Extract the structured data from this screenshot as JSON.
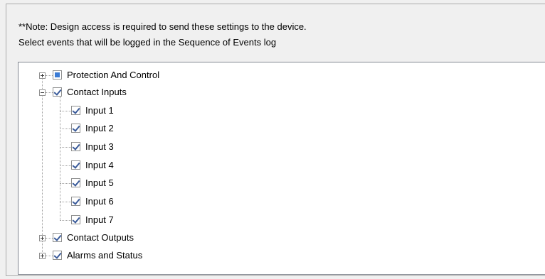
{
  "note": "**Note: Design access is required to send these settings to the device.",
  "instruction": "Select events that will be logged in the Sequence of Events log",
  "tree": {
    "protection_and_control": {
      "label": "Protection And Control",
      "state": "partial",
      "expander": "collapsed"
    },
    "contact_inputs": {
      "label": "Contact Inputs",
      "state": "checked",
      "expander": "expanded",
      "children": [
        {
          "label": "Input 1",
          "state": "checked"
        },
        {
          "label": "Input 2",
          "state": "checked"
        },
        {
          "label": "Input 3",
          "state": "checked"
        },
        {
          "label": "Input 4",
          "state": "checked"
        },
        {
          "label": "Input 5",
          "state": "checked"
        },
        {
          "label": "Input 6",
          "state": "checked"
        },
        {
          "label": "Input 7",
          "state": "checked"
        }
      ]
    },
    "contact_outputs": {
      "label": "Contact Outputs",
      "state": "checked",
      "expander": "collapsed"
    },
    "alarms_and_status": {
      "label": "Alarms and Status",
      "state": "checked",
      "expander": "collapsed"
    }
  }
}
